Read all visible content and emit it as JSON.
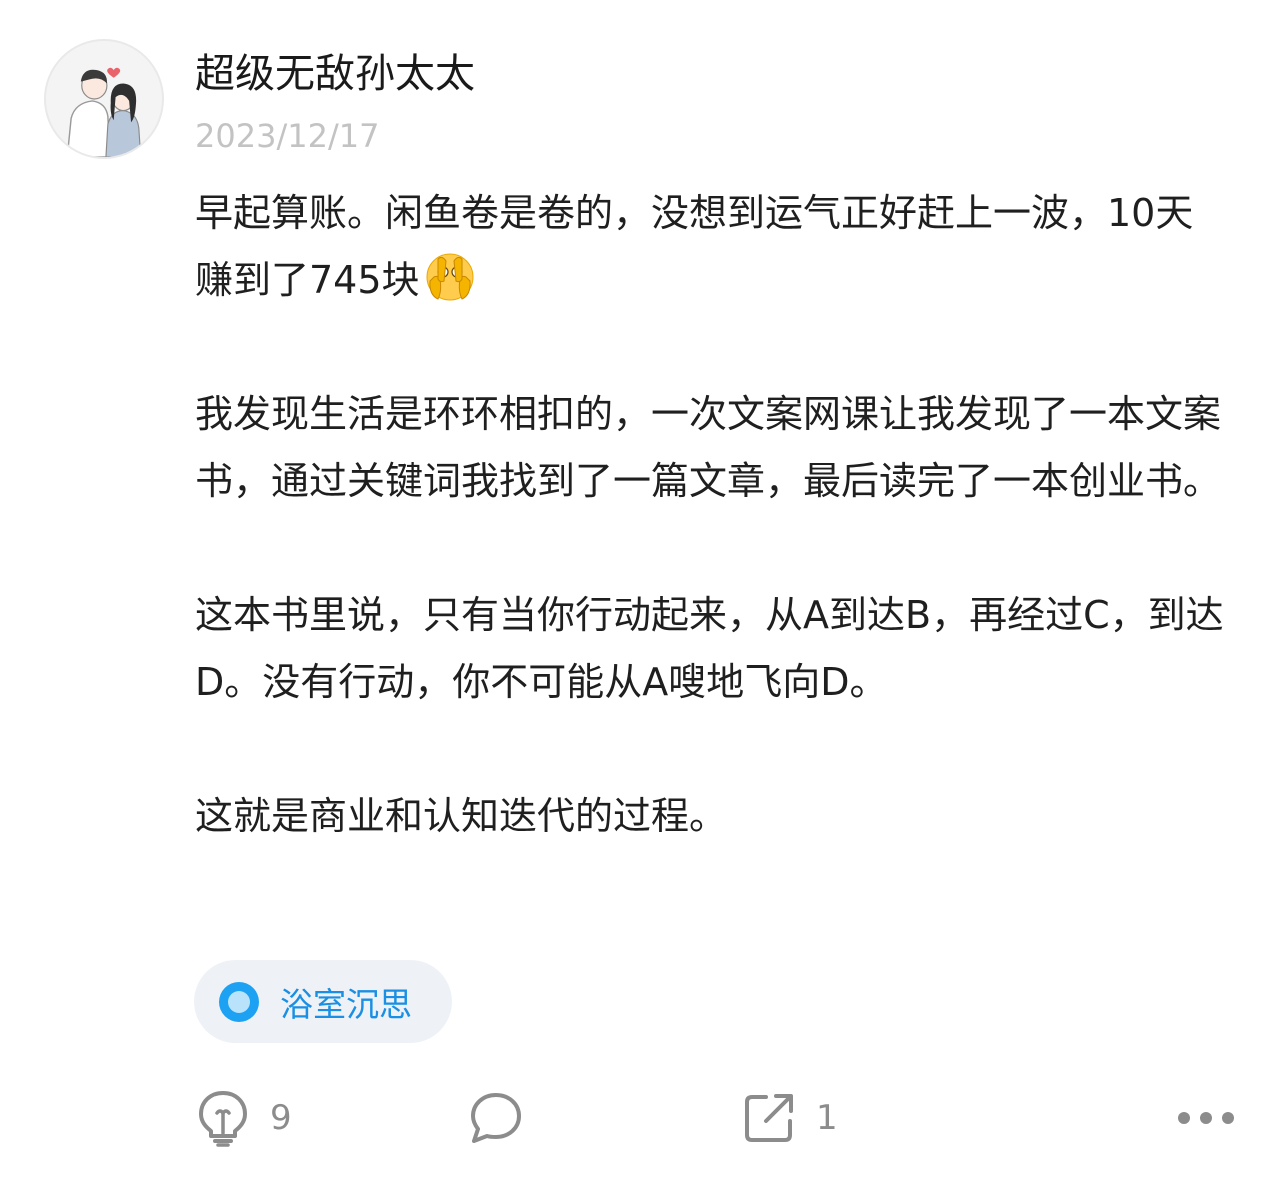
{
  "post": {
    "author_name": "超级无敌孙太太",
    "date": "2023/12/17",
    "paragraphs": [
      "早起算账。闲鱼卷是卷的，没想到运气正好赶上一波，10天赚到了745块",
      "我发现生活是环环相扣的，一次文案网课让我发现了一本文案书，通过关键词我找到了一篇文章，最后读完了一本创业书。",
      "这本书里说，只有当你行动起来，从A到达B，再经过C，到达D。没有行动，你不可能从A嗖地飞向D。",
      "这就是商业和认知迭代的过程。"
    ],
    "emoji": "face-with-open-eyes-and-hand-over-mouth-icon",
    "topic": {
      "label": "浴室沉思",
      "icon": "topic-dot-icon",
      "color": "#1a8fe3"
    }
  },
  "actions": {
    "like": {
      "icon": "lightbulb-icon",
      "count": "9"
    },
    "comment": {
      "icon": "speech-bubble-icon"
    },
    "share": {
      "icon": "share-out-icon",
      "count": "1"
    },
    "more": {
      "icon": "more-dots-icon"
    }
  },
  "colors": {
    "text": "#1f1f1f",
    "muted": "#c3c3c3",
    "action_gray": "#8c8c8c",
    "tag_bg": "#eef2f6",
    "accent": "#1a8fe3"
  }
}
